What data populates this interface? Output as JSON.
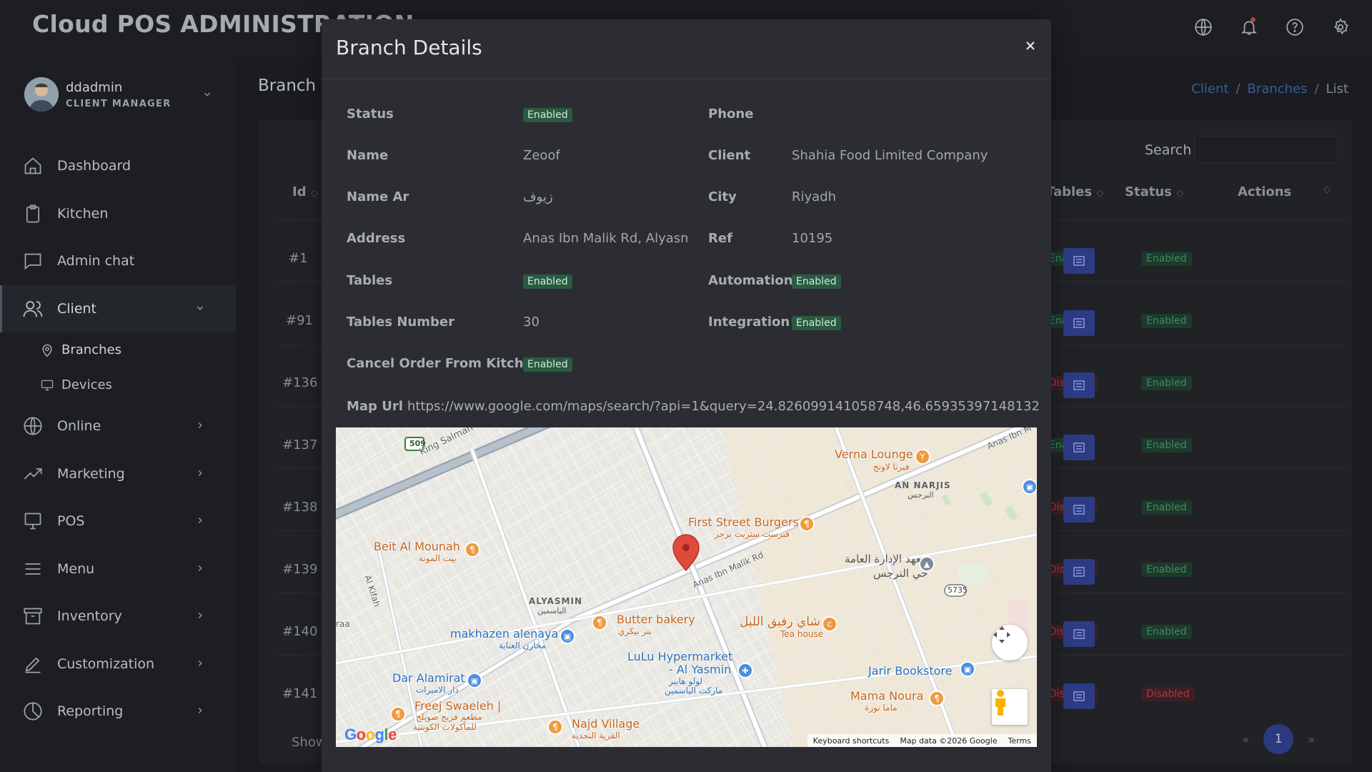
{
  "header": {
    "app_title": "Cloud POS ADMINISTRATION",
    "icons": [
      "globe-icon",
      "bell-icon",
      "help-icon",
      "settings-icon"
    ]
  },
  "sidebar": {
    "user": {
      "name": "ddadmin",
      "role": "CLIENT MANAGER"
    },
    "items": [
      {
        "label": "Dashboard",
        "icon": "home-icon"
      },
      {
        "label": "Kitchen",
        "icon": "clipboard-icon"
      },
      {
        "label": "Admin chat",
        "icon": "chat-icon"
      },
      {
        "label": "Client",
        "icon": "users-icon",
        "active": true,
        "children": [
          {
            "label": "Branches",
            "icon": "map-pin-icon"
          },
          {
            "label": "Devices",
            "icon": "monitor-icon"
          }
        ]
      },
      {
        "label": "Online",
        "icon": "globe-icon"
      },
      {
        "label": "Marketing",
        "icon": "trending-icon"
      },
      {
        "label": "POS",
        "icon": "monitor-icon"
      },
      {
        "label": "Menu",
        "icon": "menu-icon"
      },
      {
        "label": "Inventory",
        "icon": "archive-icon"
      },
      {
        "label": "Customization",
        "icon": "pen-icon"
      },
      {
        "label": "Reporting",
        "icon": "pie-chart-icon"
      }
    ]
  },
  "page": {
    "title": "Branch",
    "breadcrumb": {
      "client": "Client",
      "branches": "Branches",
      "current": "List",
      "sep": "/"
    },
    "search_label": "Search",
    "columns": {
      "id": "Id",
      "tables": "Tables",
      "status": "Status",
      "actions": "Actions"
    },
    "rows": [
      {
        "id": "#1",
        "tables": "Enabled",
        "status": "Enabled"
      },
      {
        "id": "#91",
        "tables": "Enabled",
        "status": "Enabled"
      },
      {
        "id": "#136",
        "tables": "Disabled",
        "status": "Enabled"
      },
      {
        "id": "#137",
        "tables": "Enabled",
        "status": "Enabled"
      },
      {
        "id": "#138",
        "tables": "Disabled",
        "status": "Enabled"
      },
      {
        "id": "#139",
        "tables": "Disabled",
        "status": "Enabled"
      },
      {
        "id": "#140",
        "tables": "Disabled",
        "status": "Enabled"
      },
      {
        "id": "#141",
        "tables": "Disabled",
        "status": "Disabled"
      }
    ],
    "show_label": "Show",
    "pagination": {
      "prev": "«",
      "page": "1",
      "next": "»"
    }
  },
  "modal": {
    "title": "Branch Details",
    "close": "×",
    "fields": {
      "status_label": "Status",
      "status_value": "Enabled",
      "phone_label": "Phone",
      "name_label": "Name",
      "name_value": "Zeoof",
      "client_label": "Client",
      "client_value": "Shahia Food Limited Company",
      "name_ar_label": "Name Ar",
      "name_ar_value": "زيوف",
      "city_label": "City",
      "city_value": "Riyadh",
      "address_label": "Address",
      "address_value": "Anas Ibn Malik Rd, Alyasmin",
      "ref_label": "Ref",
      "ref_value": "10195",
      "tables_label": "Tables",
      "tables_value": "Enabled",
      "automation_label": "Automation",
      "automation_value": "Enabled",
      "tables_number_label": "Tables Number",
      "tables_number_value": "30",
      "integration_label": "Integration",
      "integration_value": "Enabled",
      "cancel_order_label": "Cancel Order From Kitchen",
      "cancel_order_value": "Enabled",
      "map_url_label": "Map Url",
      "map_url_value": "https://www.google.com/maps/search/?api=1&query=24.826099141058748,46.65935397148132"
    }
  },
  "map": {
    "labels": {
      "verna_en": "Verna Lounge",
      "verna_ar": "فيرنا لاونج",
      "an_narjis_en": "AN NARJIS",
      "an_narjis_ar": "النرجس",
      "first_street_en": "First Street Burgers",
      "first_street_ar": "فيرست ستريت برجر",
      "beit_en": "Beit Al Mounah",
      "beit_ar": "بيت المونة",
      "institute_ar1": "معهد الإدارة العامة",
      "institute_ar2": "حي النرجس",
      "alyasmin_en": "ALYASMIN",
      "alyasmin_ar": "الياسمين",
      "butter_en": "Butter bakery",
      "butter_ar": "بتر بيكري",
      "tea_ar": "شاي رفيق الليل",
      "tea_en": "Tea house",
      "makhazen_en": "makhazen alenaya",
      "makhazen_ar": "مخازن العناية",
      "lulu_en1": "LuLu Hypermarket",
      "lulu_en2": "- Al Yasmin",
      "lulu_ar1": "لولو هايبر",
      "lulu_ar2": "ماركت الياسمين",
      "jarir_en": "Jarir Bookstore",
      "dar_en": "Dar Alamirat",
      "dar_ar": "دار الاميرات",
      "mama_en": "Mama Noura",
      "mama_ar": "ماما نورة",
      "freej_en": "Freej Swaeleh |",
      "freej_ar1": "مطعم فريج صويلح",
      "freej_ar2": "للمأكولات الكويتية",
      "najd_en": "Najd Village",
      "najd_ar": "القرية النجدية",
      "king_salman": "King Salman Bin Abdulaziz",
      "anas_rd": "Anas Ibn Malik Rd",
      "anas_rd_corner": "Anas Ibn M",
      "al_kifah": "Al Kifah",
      "raa": "raa",
      "shield_509": "509",
      "shield_5735": "5735"
    },
    "footer": {
      "keyboard": "Keyboard shortcuts",
      "data": "Map data ©2026 Google",
      "terms": "Terms"
    },
    "logo": "Google"
  }
}
